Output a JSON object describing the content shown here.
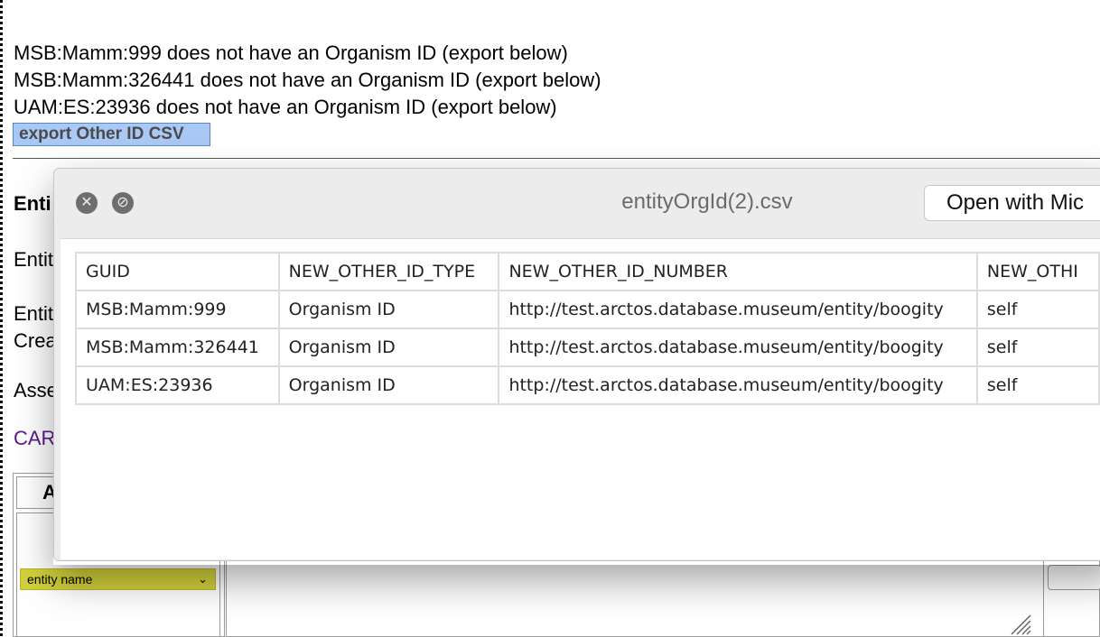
{
  "messages": [
    "MSB:Mamm:999 does not have an Organism ID (export below)",
    "MSB:Mamm:326441 does not have an Organism ID (export below)",
    "UAM:ES:23936 does not have an Organism ID (export below)"
  ],
  "export_button": "export Other ID CSV",
  "background": {
    "label_entity_title": "Enti",
    "label_entity": "Entit",
    "label_entity_created_1": "Entit",
    "label_entity_created_2": "Crea",
    "label_assert": "Asse",
    "link_car": "CAR",
    "panel_letter": "A",
    "select_value": "entity name"
  },
  "quicklook": {
    "title": "entityOrgId(2).csv",
    "open_button": "Open with Mic",
    "close_icon": "close-icon",
    "fullscreen_icon": "no-fullscreen-icon",
    "headers": [
      "GUID",
      "NEW_OTHER_ID_TYPE",
      "NEW_OTHER_ID_NUMBER",
      "NEW_OTHI"
    ],
    "rows": [
      [
        "MSB:Mamm:999",
        "Organism ID",
        "http://test.arctos.database.museum/entity/boogity",
        "self"
      ],
      [
        "MSB:Mamm:326441",
        "Organism ID",
        "http://test.arctos.database.museum/entity/boogity",
        "self"
      ],
      [
        "UAM:ES:23936",
        "Organism ID",
        "http://test.arctos.database.museum/entity/boogity",
        "self"
      ]
    ]
  },
  "colors": {
    "export_button_bg": "#a9c8f5",
    "select_bg": "#d3d13a",
    "link": "#5a1a8c"
  }
}
